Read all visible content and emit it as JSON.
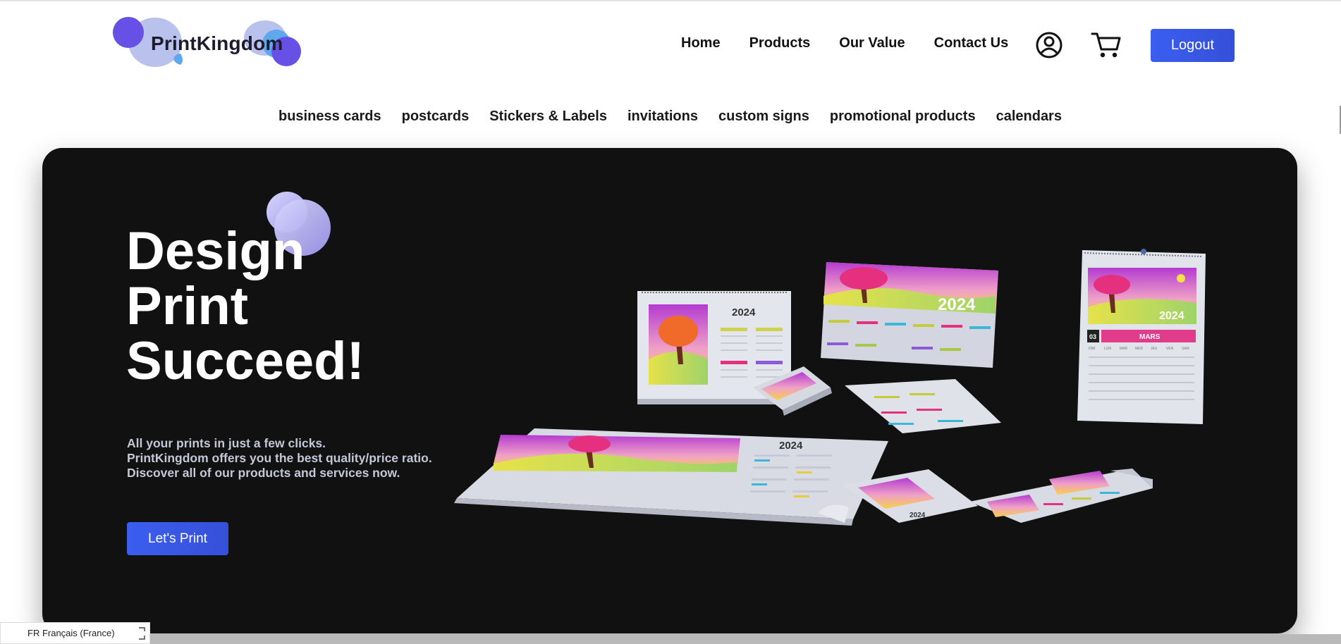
{
  "brand": {
    "name": "PrintKingdom"
  },
  "nav": {
    "items": [
      {
        "label": "Home"
      },
      {
        "label": "Products"
      },
      {
        "label": "Our Value"
      },
      {
        "label": "Contact Us"
      }
    ],
    "account_icon": "user-circle-icon",
    "cart_icon": "shopping-cart-icon",
    "logout_label": "Logout"
  },
  "categories": [
    {
      "label": "business cards"
    },
    {
      "label": "postcards"
    },
    {
      "label": "Stickers & Labels"
    },
    {
      "label": "invitations"
    },
    {
      "label": "custom signs"
    },
    {
      "label": "promotional products"
    },
    {
      "label": "calendars"
    }
  ],
  "hero": {
    "title_lines": [
      "Design",
      "Print",
      "Succeed!"
    ],
    "subtitle_lines": [
      "All your prints in just a few clicks.",
      "PrintKingdom offers you the best quality/price ratio.",
      "Discover all of our products and services now."
    ],
    "cta_label": "Let's Print",
    "image": {
      "year": "2024",
      "month_number": "03",
      "month_name": "MARS",
      "weekday_headers": [
        "DIM",
        "LUN",
        "MAR",
        "MER",
        "JEU",
        "VEN",
        "SAM"
      ]
    }
  },
  "status": {
    "language": "FR Français (France)"
  },
  "colors": {
    "accent": "#3B5EF0",
    "hero_bg": "#121111",
    "logo_purple": "#6650E6",
    "logo_lavender": "#B9C2EC",
    "logo_blue": "#5FA8EE"
  }
}
